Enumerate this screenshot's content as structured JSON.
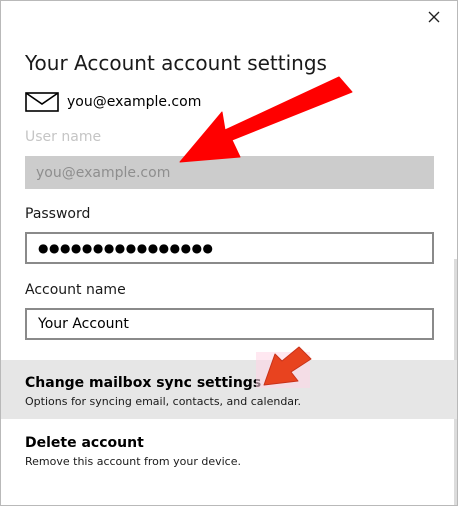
{
  "dialog": {
    "title": "Your Account account settings",
    "account_email": "you@example.com",
    "close_icon": "close-icon"
  },
  "form": {
    "username_label": "User name",
    "username_value": "you@example.com",
    "password_label": "Password",
    "password_value": "●●●●●●●●●●●●●●●●",
    "account_name_label": "Account name",
    "account_name_value": "Your Account"
  },
  "options": [
    {
      "title": "Change mailbox sync settings",
      "description": "Options for syncing email, contacts, and calendar."
    },
    {
      "title": "Delete account",
      "description": "Remove this account from your device."
    }
  ],
  "colors": {
    "annotation_arrow": "#ff0000",
    "annotation_arrow_small": "#e8431f",
    "highlight_row": "#e6e6e6",
    "disabled_field": "#cccccc"
  }
}
